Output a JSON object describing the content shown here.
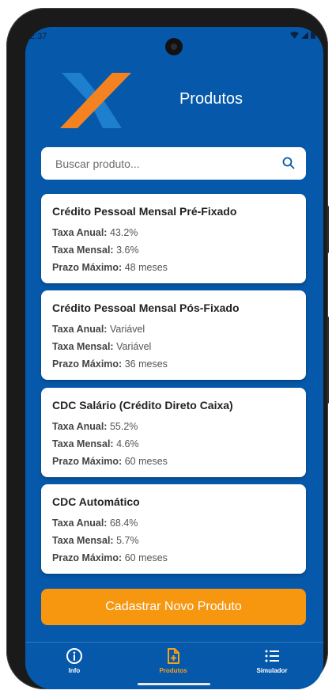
{
  "status_bar": {
    "time": "2:37"
  },
  "header": {
    "title": "Produtos"
  },
  "search": {
    "placeholder": "Buscar produto..."
  },
  "products": [
    {
      "name": "Crédito Pessoal Mensal Pré-Fixado",
      "taxa_anual_label": "Taxa Anual:",
      "taxa_anual": "43.2%",
      "taxa_mensal_label": "Taxa Mensal:",
      "taxa_mensal": "3.6%",
      "prazo_label": "Prazo Máximo:",
      "prazo": "48 meses"
    },
    {
      "name": "Crédito Pessoal Mensal Pós-Fixado",
      "taxa_anual_label": "Taxa Anual:",
      "taxa_anual": "Variável",
      "taxa_mensal_label": "Taxa Mensal:",
      "taxa_mensal": "Variável",
      "prazo_label": "Prazo Máximo:",
      "prazo": "36 meses"
    },
    {
      "name": "CDC Salário (Crédito Direto Caixa)",
      "taxa_anual_label": "Taxa Anual:",
      "taxa_anual": "55.2%",
      "taxa_mensal_label": "Taxa Mensal:",
      "taxa_mensal": "4.6%",
      "prazo_label": "Prazo Máximo:",
      "prazo": "60 meses"
    },
    {
      "name": "CDC Automático",
      "taxa_anual_label": "Taxa Anual:",
      "taxa_anual": "68.4%",
      "taxa_mensal_label": "Taxa Mensal:",
      "taxa_mensal": "5.7%",
      "prazo_label": "Prazo Máximo:",
      "prazo": "60 meses"
    }
  ],
  "cta": {
    "label": "Cadastrar Novo Produto"
  },
  "tabs": [
    {
      "label": "Info",
      "icon": "info-icon",
      "active": false
    },
    {
      "label": "Produtos",
      "icon": "document-plus-icon",
      "active": true
    },
    {
      "label": "Simulador",
      "icon": "list-icon",
      "active": false
    }
  ],
  "colors": {
    "background": "#0659aa",
    "accent": "#f7960f",
    "logo_orange": "#f58220",
    "logo_blue": "#1f7fcf",
    "card": "#ffffff"
  }
}
